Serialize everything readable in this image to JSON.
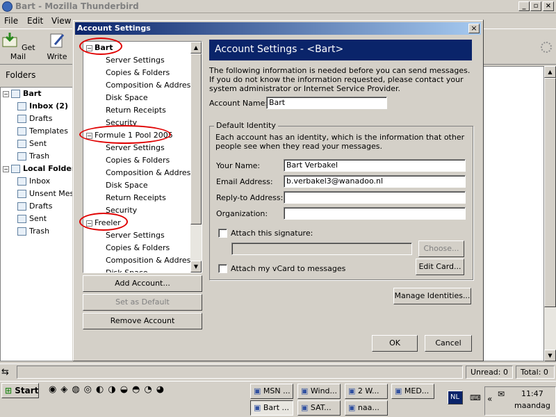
{
  "window": {
    "title": "Bart - Mozilla Thunderbird"
  },
  "menu": {
    "file": "File",
    "edit": "Edit",
    "view": "View"
  },
  "toolbar": {
    "getmail": "Get Mail",
    "write": "Write"
  },
  "folders": {
    "header": "Folders",
    "items": [
      {
        "label": "Bart",
        "level": 0
      },
      {
        "label": "Inbox (2)",
        "level": 1
      },
      {
        "label": "Drafts",
        "level": 1
      },
      {
        "label": "Templates",
        "level": 1
      },
      {
        "label": "Sent",
        "level": 1
      },
      {
        "label": "Trash",
        "level": 1
      },
      {
        "label": "Local Folders",
        "level": 0
      },
      {
        "label": "Inbox",
        "level": 1
      },
      {
        "label": "Unsent Messages",
        "level": 1
      },
      {
        "label": "Drafts",
        "level": 1
      },
      {
        "label": "Sent",
        "level": 1
      },
      {
        "label": "Trash",
        "level": 1
      }
    ]
  },
  "status": {
    "unread": "Unread: 0",
    "total": "Total: 0"
  },
  "dialog": {
    "title": "Account Settings",
    "close": "×",
    "tree": [
      {
        "label": "Bart",
        "account": true
      },
      {
        "label": "Server Settings"
      },
      {
        "label": "Copies & Folders"
      },
      {
        "label": "Composition & Addressing"
      },
      {
        "label": "Disk Space"
      },
      {
        "label": "Return Receipts"
      },
      {
        "label": "Security"
      },
      {
        "label": "Formule 1 Pool 2005",
        "account": true
      },
      {
        "label": "Server Settings"
      },
      {
        "label": "Copies & Folders"
      },
      {
        "label": "Composition & Addressing"
      },
      {
        "label": "Disk Space"
      },
      {
        "label": "Return Receipts"
      },
      {
        "label": "Security"
      },
      {
        "label": "Freeler",
        "account": true
      },
      {
        "label": "Server Settings"
      },
      {
        "label": "Copies & Folders"
      },
      {
        "label": "Composition & Addressing"
      },
      {
        "label": "Disk Space"
      }
    ],
    "buttons": {
      "add": "Add Account...",
      "default": "Set as Default",
      "remove": "Remove Account",
      "ok": "OK",
      "cancel": "Cancel"
    },
    "heading": "Account Settings - <Bart>",
    "intro": "The following information is needed before you can send messages. If you do not know the information requested, please contact your system administrator or Internet Service Provider.",
    "account_name_label": "Account Name:",
    "account_name_value": "Bart",
    "identity": {
      "legend": "Default Identity",
      "desc": "Each account has an identity, which is the information that other people see when they read your messages.",
      "name_label": "Your Name:",
      "name_value": "Bart Verbakel",
      "email_label": "Email Address:",
      "email_value": "b.verbakel3@wanadoo.nl",
      "reply_label": "Reply-to Address:",
      "reply_value": "",
      "org_label": "Organization:",
      "org_value": "",
      "sig_label": "Attach this signature:",
      "choose": "Choose...",
      "vcard_label": "Attach my vCard to messages",
      "editcard": "Edit Card..."
    },
    "manage": "Manage Identities..."
  },
  "taskbar": {
    "start": "Start",
    "items": [
      "MSN ...",
      "Wind...",
      "2 W...",
      "MED...",
      "Bart ...",
      "SAT...",
      "naa..."
    ],
    "lang": "NL",
    "time": "11:47",
    "day": "maandag"
  }
}
